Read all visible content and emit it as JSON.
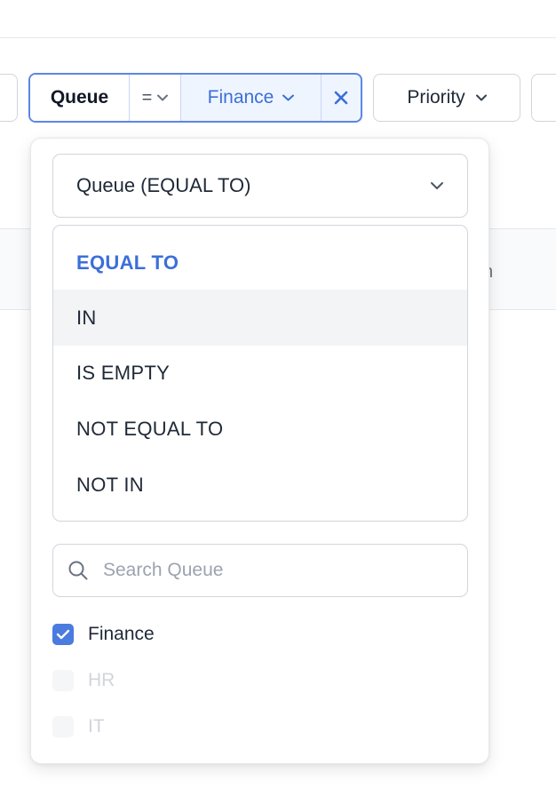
{
  "filter_bar": {
    "queue_chip": {
      "field": "Queue",
      "operator": "=",
      "value": "Finance"
    },
    "priority_chip": {
      "label": "Priority"
    }
  },
  "table": {
    "partial_header_text": "n"
  },
  "dropdown": {
    "operator_select": {
      "value": "Queue (EQUAL TO)"
    },
    "operators": [
      {
        "label": "EQUAL TO",
        "state": "selected"
      },
      {
        "label": "IN",
        "state": "hovered"
      },
      {
        "label": "IS EMPTY",
        "state": "normal"
      },
      {
        "label": "NOT EQUAL TO",
        "state": "normal"
      },
      {
        "label": "NOT IN",
        "state": "normal"
      }
    ],
    "search": {
      "placeholder": "Search Queue",
      "value": ""
    },
    "options": [
      {
        "label": "Finance",
        "checked": true,
        "disabled": false
      },
      {
        "label": "HR",
        "checked": false,
        "disabled": true
      },
      {
        "label": "IT",
        "checked": false,
        "disabled": true
      }
    ]
  },
  "colors": {
    "accent": "#3b6fd9",
    "chip_border": "#5b86e5",
    "chip_bg": "#eff5ff",
    "checkbox_checked": "#4a7bde",
    "hover_bg": "#f3f4f6",
    "border": "#d1d5db"
  }
}
